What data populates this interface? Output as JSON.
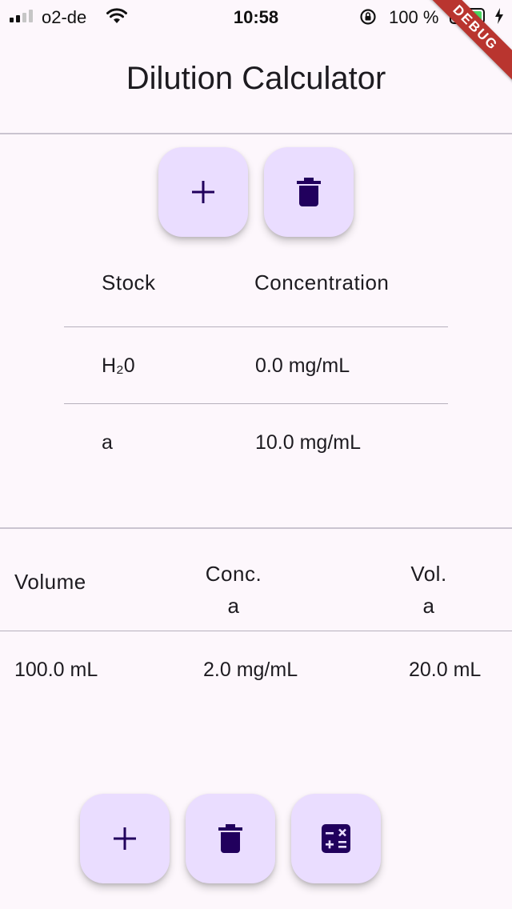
{
  "status_bar": {
    "carrier": "o2-de",
    "time": "10:58",
    "battery": "100 %",
    "battery_level": 1.0,
    "icons": [
      "signal-icon",
      "wifi-icon",
      "rotation-lock-icon",
      "battery-icon",
      "charging-icon"
    ]
  },
  "debug_banner": "DEBUG",
  "app_bar": {
    "title": "Dilution Calculator"
  },
  "stock_actions": {
    "add_icon": "plus-icon",
    "delete_icon": "trash-icon"
  },
  "stock_table": {
    "headers": [
      "Stock",
      "Concentration"
    ],
    "rows": [
      {
        "stock": "H₂0",
        "concentration": "0.0 mg/mL"
      },
      {
        "stock": "a",
        "concentration": "10.0 mg/mL"
      }
    ]
  },
  "dilution_table": {
    "headers": [
      {
        "line1": "Volume",
        "line2": ""
      },
      {
        "line1": "Conc.",
        "line2": "a"
      },
      {
        "line1": "Vol.",
        "line2": "a"
      }
    ],
    "rows": [
      {
        "volume": "100.0 mL",
        "conc": "2.0 mg/mL",
        "vol": "20.0 mL"
      }
    ]
  },
  "bottom_actions": {
    "add_icon": "plus-icon",
    "delete_icon": "trash-icon",
    "calculate_icon": "calculator-icon"
  },
  "colors": {
    "background": "#fdf7fc",
    "fab_background": "#eaddff",
    "icon": "#21005d",
    "divider": "#cac4d0",
    "debug_banner": "#b9352f",
    "battery_fill": "#4cd964"
  }
}
